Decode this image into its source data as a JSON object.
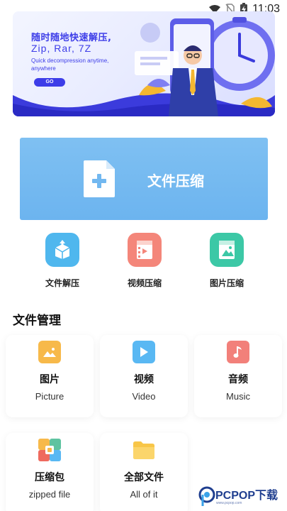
{
  "status_bar": {
    "time": "11:03",
    "icons": [
      "wifi-icon",
      "no-sim-icon",
      "battery-charging-icon"
    ]
  },
  "banner": {
    "title": "随时随地快速解压,",
    "subtitle": "Zip, Rar, 7Z",
    "description": "Quick decompression anytime, anywhere",
    "go_label": "GO"
  },
  "compress_card": {
    "label": "文件压缩",
    "icon": "add-file-icon",
    "color": "#72b8f0"
  },
  "tools": [
    {
      "label": "文件解压",
      "icon": "unzip-box-icon",
      "color": "#4fb7ee"
    },
    {
      "label": "视频压缩",
      "icon": "video-zip-icon",
      "color": "#f4867a"
    },
    {
      "label": "图片压缩",
      "icon": "image-zip-icon",
      "color": "#3cc8a6"
    }
  ],
  "file_management": {
    "title": "文件管理",
    "items": [
      {
        "name": "图片",
        "en": "Picture",
        "icon": "picture-icon",
        "color": "#f7b94a"
      },
      {
        "name": "视频",
        "en": "Video",
        "icon": "video-play-icon",
        "color": "#59b8f3"
      },
      {
        "name": "音频",
        "en": "Music",
        "icon": "music-note-icon",
        "color": "#f2807a"
      },
      {
        "name": "压缩包",
        "en": "zipped file",
        "icon": "zip-archive-icon",
        "color": "#ef6a5e"
      },
      {
        "name": "全部文件",
        "en": "All of it",
        "icon": "folder-icon",
        "color": "#f8c648"
      }
    ]
  },
  "watermark": {
    "brand": "PCPOP下载",
    "tagline": "www.pcpop.com"
  }
}
